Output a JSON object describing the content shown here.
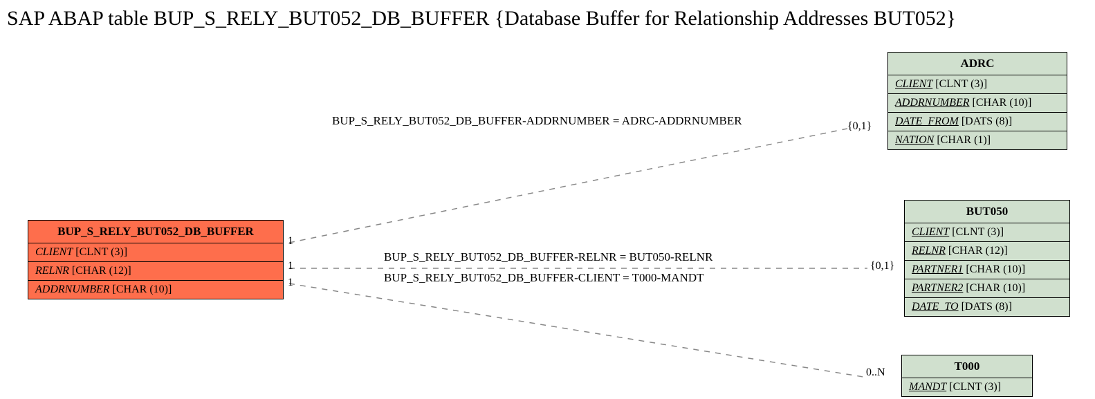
{
  "title": "SAP ABAP table BUP_S_RELY_BUT052_DB_BUFFER {Database Buffer for Relationship Addresses BUT052}",
  "mainEntity": {
    "name": "BUP_S_RELY_BUT052_DB_BUFFER",
    "fields": [
      {
        "label": "CLIENT",
        "type": " [CLNT (3)]"
      },
      {
        "label": "RELNR",
        "type": " [CHAR (12)]"
      },
      {
        "label": "ADDRNUMBER",
        "type": " [CHAR (10)]"
      }
    ]
  },
  "adrc": {
    "name": "ADRC",
    "fields": [
      {
        "label": "CLIENT",
        "type": " [CLNT (3)]",
        "key": true
      },
      {
        "label": "ADDRNUMBER",
        "type": " [CHAR (10)]",
        "key": true
      },
      {
        "label": "DATE_FROM",
        "type": " [DATS (8)]",
        "key": true
      },
      {
        "label": "NATION",
        "type": " [CHAR (1)]",
        "key": true
      }
    ]
  },
  "but050": {
    "name": "BUT050",
    "fields": [
      {
        "label": "CLIENT",
        "type": " [CLNT (3)]",
        "key": true
      },
      {
        "label": "RELNR",
        "type": " [CHAR (12)]",
        "key": true
      },
      {
        "label": "PARTNER1",
        "type": " [CHAR (10)]",
        "key": true
      },
      {
        "label": "PARTNER2",
        "type": " [CHAR (10)]",
        "key": true
      },
      {
        "label": "DATE_TO",
        "type": " [DATS (8)]",
        "key": true
      }
    ]
  },
  "t000": {
    "name": "T000",
    "fields": [
      {
        "label": "MANDT",
        "type": " [CLNT (3)]",
        "key": true
      }
    ]
  },
  "relations": {
    "r1": "BUP_S_RELY_BUT052_DB_BUFFER-ADDRNUMBER = ADRC-ADDRNUMBER",
    "r2": "BUP_S_RELY_BUT052_DB_BUFFER-RELNR = BUT050-RELNR",
    "r3": "BUP_S_RELY_BUT052_DB_BUFFER-CLIENT = T000-MANDT"
  },
  "cardinalities": {
    "left1": "1",
    "left2": "1",
    "left3": "1",
    "right1": "{0,1}",
    "right2": "{0,1}",
    "right3": "0..N"
  }
}
